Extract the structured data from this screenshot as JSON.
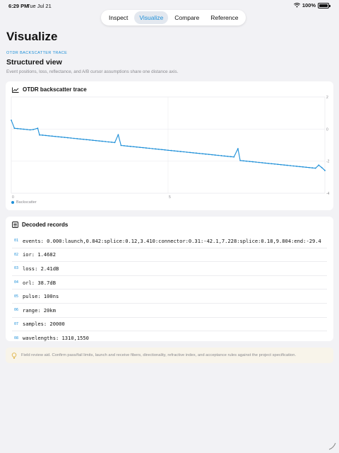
{
  "status": {
    "time": "6:29 PM",
    "date": "Tue Jul 21",
    "battery": "100%"
  },
  "tabs": [
    {
      "label": "Inspect",
      "active": false
    },
    {
      "label": "Visualize",
      "active": true
    },
    {
      "label": "Compare",
      "active": false
    },
    {
      "label": "Reference",
      "active": false
    }
  ],
  "page": {
    "title": "Visualize"
  },
  "section": {
    "eyebrow": "OTDR BACKSCATTER TRACE",
    "title": "Structured view",
    "subtitle": "Event positions, loss, reflectance, and A/B cursor assumptions share one distance axis."
  },
  "chart_card": {
    "title": "OTDR backscatter trace",
    "icon": "chart-line-icon"
  },
  "chart_data": {
    "type": "line",
    "title": "OTDR backscatter trace",
    "xlabel": "",
    "ylabel": "",
    "xlim": [
      0,
      10
    ],
    "ylim": [
      -4,
      2
    ],
    "x_ticks": [
      "0",
      "5"
    ],
    "y_ticks": [
      "2",
      "0",
      "-2",
      "-4"
    ],
    "grid": true,
    "legend_position": "bottom-left",
    "series": [
      {
        "name": "Backscatter",
        "color": "#1d8fd8",
        "x": [
          0.0,
          0.1,
          0.2,
          0.3,
          0.4,
          0.5,
          0.6,
          0.7,
          0.842,
          0.9,
          1.0,
          1.1,
          1.2,
          1.3,
          1.4,
          1.5,
          1.6,
          1.7,
          1.8,
          1.9,
          2.0,
          2.1,
          2.2,
          2.3,
          2.4,
          2.5,
          2.6,
          2.7,
          2.8,
          2.9,
          3.0,
          3.1,
          3.2,
          3.3,
          3.41,
          3.5,
          3.6,
          3.7,
          3.8,
          3.9,
          4.0,
          4.1,
          4.2,
          4.3,
          4.4,
          4.5,
          4.6,
          4.7,
          4.8,
          4.9,
          5.0,
          5.1,
          5.2,
          5.3,
          5.4,
          5.5,
          5.6,
          5.7,
          5.8,
          5.9,
          6.0,
          6.1,
          6.2,
          6.3,
          6.4,
          6.5,
          6.6,
          6.7,
          6.8,
          6.9,
          7.0,
          7.1,
          7.228,
          7.3,
          7.4,
          7.5,
          7.6,
          7.7,
          7.8,
          7.9,
          8.0,
          8.1,
          8.2,
          8.3,
          8.4,
          8.5,
          8.6,
          8.7,
          8.8,
          8.9,
          9.0,
          9.1,
          9.2,
          9.3,
          9.4,
          9.5,
          9.6,
          9.7,
          9.804,
          9.9,
          10.0
        ],
        "values": [
          0.55,
          0.05,
          0.03,
          0.01,
          -0.01,
          -0.03,
          -0.05,
          -0.03,
          0.05,
          -0.37,
          -0.38,
          -0.4,
          -0.42,
          -0.44,
          -0.46,
          -0.48,
          -0.5,
          -0.52,
          -0.54,
          -0.56,
          -0.58,
          -0.6,
          -0.62,
          -0.64,
          -0.66,
          -0.68,
          -0.7,
          -0.72,
          -0.74,
          -0.76,
          -0.78,
          -0.8,
          -0.82,
          -0.84,
          -0.35,
          -1.02,
          -1.04,
          -1.06,
          -1.08,
          -1.1,
          -1.12,
          -1.14,
          -1.16,
          -1.18,
          -1.2,
          -1.22,
          -1.24,
          -1.26,
          -1.28,
          -1.3,
          -1.32,
          -1.34,
          -1.36,
          -1.38,
          -1.4,
          -1.42,
          -1.44,
          -1.46,
          -1.48,
          -1.5,
          -1.52,
          -1.54,
          -1.56,
          -1.58,
          -1.6,
          -1.62,
          -1.64,
          -1.66,
          -1.68,
          -1.7,
          -1.72,
          -1.74,
          -1.22,
          -1.96,
          -1.98,
          -2.0,
          -2.02,
          -2.04,
          -2.06,
          -2.08,
          -2.1,
          -2.12,
          -2.14,
          -2.16,
          -2.18,
          -2.2,
          -2.22,
          -2.24,
          -2.26,
          -2.28,
          -2.3,
          -2.32,
          -2.34,
          -2.36,
          -2.38,
          -2.4,
          -2.42,
          -2.44,
          -2.25,
          -2.4,
          -2.58
        ]
      }
    ]
  },
  "records_card": {
    "title": "Decoded records",
    "icon": "list-icon",
    "rows": [
      {
        "index": "01",
        "text": "events: 0.000:launch,0.842:splice:0.12,3.410:connector:0.31:-42.1,7.228:splice:0.18,9.804:end:-29.4"
      },
      {
        "index": "02",
        "text": "ior: 1.4682"
      },
      {
        "index": "03",
        "text": "loss: 2.41dB"
      },
      {
        "index": "04",
        "text": "orl: 38.7dB"
      },
      {
        "index": "05",
        "text": "pulse: 100ns"
      },
      {
        "index": "06",
        "text": "range: 20km"
      },
      {
        "index": "07",
        "text": "samples: 20000"
      },
      {
        "index": "08",
        "text": "wavelengths: 1310,1550"
      }
    ]
  },
  "note": {
    "icon": "lightbulb-icon",
    "text": "Field review aid. Confirm pass/fail limits, launch and receive fibers, directionality, refractive index, and acceptance rules against the project specification."
  }
}
